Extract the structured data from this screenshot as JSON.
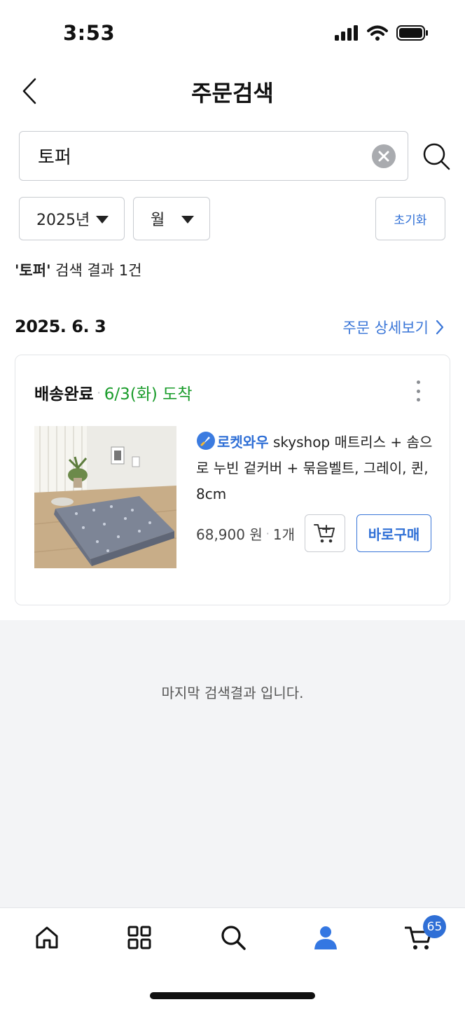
{
  "status_bar": {
    "time": "3:53"
  },
  "header": {
    "title": "주문검색"
  },
  "search": {
    "value": "토퍼",
    "placeholder": ""
  },
  "filters": {
    "year": "2025년",
    "month": "월",
    "reset_label": "초기화"
  },
  "result_summary": {
    "keyword": "'토퍼'",
    "text": " 검색 결과 1건"
  },
  "order_group": {
    "date": "2025. 6. 3",
    "detail_link_label": "주문 상세보기",
    "order": {
      "status": "배송완료",
      "separator": "·",
      "arrival": "6/3(화) 도착",
      "product": {
        "badge": "로켓와우",
        "title": " skyshop 매트리스 + 솜으로 누빈 겉커버 + 묶음벨트, 그레이, 퀸, 8cm",
        "price": "68,900 원",
        "quantity": "1개",
        "buy_now_label": "바로구매"
      }
    }
  },
  "end_message": "마지막 검색결과 입니다.",
  "tab_bar": {
    "cart_badge": "65"
  },
  "icons": {
    "back": "chevron-left-icon",
    "clear": "clear-x-icon",
    "search": "magnifier-icon",
    "more": "more-vertical-icon",
    "cart_add": "cart-plus-icon",
    "home": "home-icon",
    "category": "grid-icon",
    "tab_search": "search-icon",
    "my": "person-icon",
    "cart": "cart-icon"
  },
  "colors": {
    "accent": "#2f6fd6",
    "arrival_green": "#1a9c2b"
  }
}
